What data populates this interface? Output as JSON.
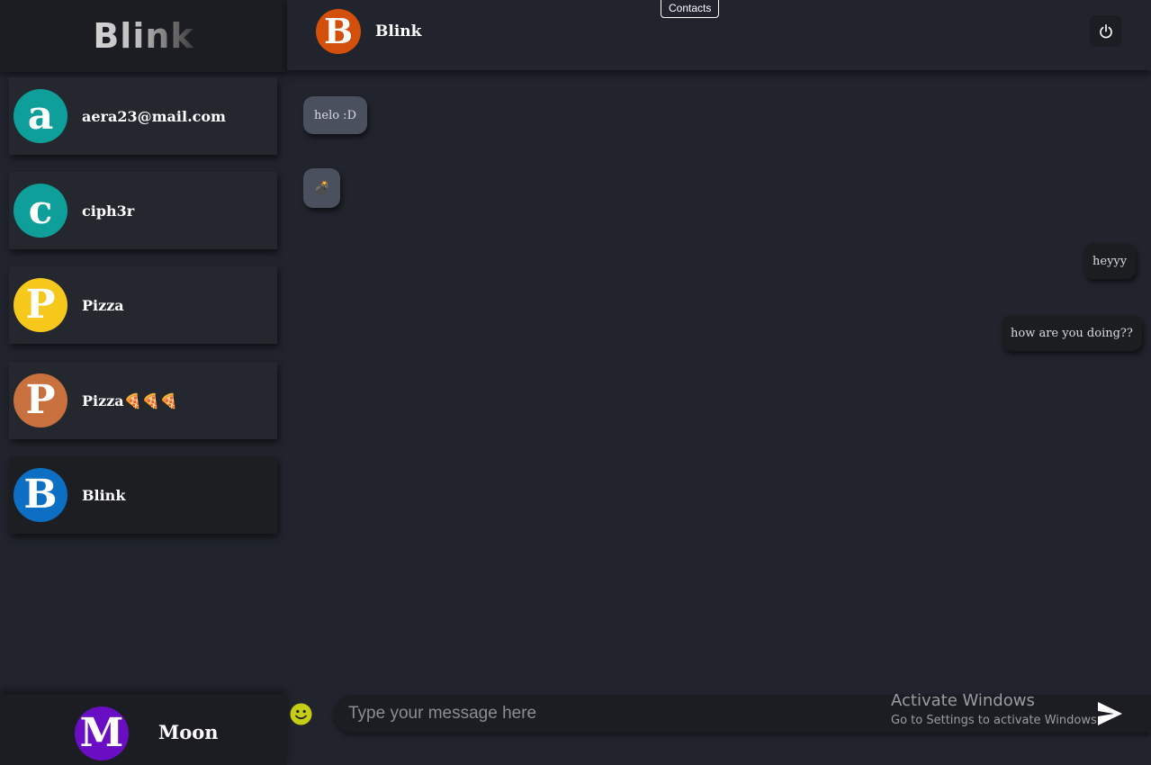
{
  "app": {
    "brand": "Blink"
  },
  "sidebar": {
    "contacts": [
      {
        "initial": "a",
        "name": "aera23@mail.com",
        "color": "#0e9f9a"
      },
      {
        "initial": "c",
        "name": "ciph3r",
        "color": "#0e9f9a"
      },
      {
        "initial": "P",
        "name": "Pizza",
        "color": "#f5c81b"
      },
      {
        "initial": "P",
        "name": "Pizza🍕🍕🍕",
        "color": "#c8703e"
      },
      {
        "initial": "B",
        "name": "Blink",
        "color": "#0d6fc4",
        "active": true
      }
    ],
    "current_user": {
      "initial": "M",
      "name": "Moon",
      "color": "#6a0ec4"
    }
  },
  "header": {
    "contacts_tab": "Contacts",
    "chat_initial": "B",
    "chat_title": "Blink",
    "chat_color": "#d3500c",
    "power_icon": "power-icon"
  },
  "messages": [
    {
      "text": "helo :D",
      "direction": "incoming"
    },
    {
      "text": "💣",
      "direction": "incoming"
    },
    {
      "text": "heyyy",
      "direction": "outgoing"
    },
    {
      "text": "how are you doing??",
      "direction": "outgoing"
    }
  ],
  "composer": {
    "placeholder": "Type your message here",
    "emoji_icon": "smiley-icon",
    "send_icon": "send-icon"
  },
  "watermark": {
    "line1": "Activate Windows",
    "line2": "Go to Settings to activate Windows."
  }
}
